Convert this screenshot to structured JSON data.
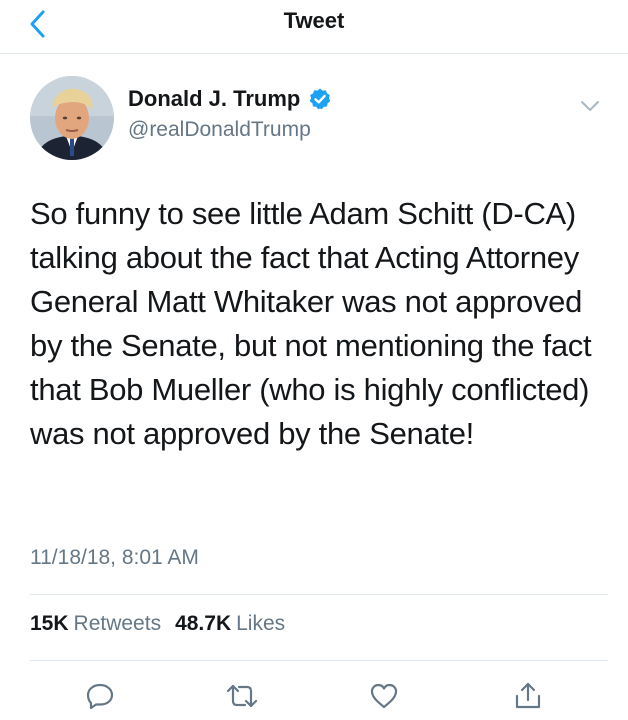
{
  "nav": {
    "title": "Tweet"
  },
  "tweet": {
    "display_name": "Donald J. Trump",
    "username": "@realDonaldTrump",
    "verified": true,
    "text": "So funny to see little Adam Schitt (D-CA) talking about the fact that Acting Attorney General Matt Whitaker was not approved by the Senate, but not mentioning the fact that Bob Mueller (who is highly conflicted) was not approved by the Senate!",
    "timestamp": "11/18/18, 8:01 AM"
  },
  "stats": {
    "retweets_count": "15K",
    "retweets_label": "Retweets",
    "likes_count": "48.7K",
    "likes_label": "Likes"
  },
  "icons": {
    "back": "chevron-left-icon",
    "verified": "verified-badge-icon",
    "more": "chevron-down-icon",
    "reply": "reply-icon",
    "retweet": "retweet-icon",
    "like": "heart-icon",
    "share": "share-icon"
  },
  "colors": {
    "accent": "#1da1f2",
    "text": "#14171a",
    "secondary": "#657786",
    "divider": "#e1e8ed"
  }
}
